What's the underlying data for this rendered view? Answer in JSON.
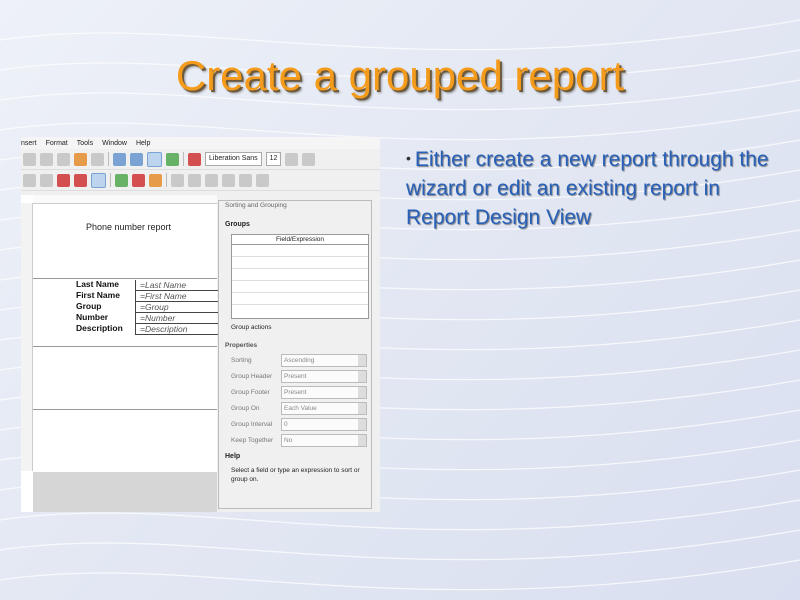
{
  "slide": {
    "title": "Create a grouped report",
    "bullet": "Either create a new report through the wizard or edit an existing report in Report Design View"
  },
  "app": {
    "menu": [
      "nsert",
      "Format",
      "Tools",
      "Window",
      "Help"
    ],
    "font_name": "Liberation Sans",
    "font_size": "12"
  },
  "report": {
    "page_title": "Phone number report",
    "labels": [
      "Last Name",
      "First Name",
      "Group",
      "Number",
      "Description"
    ],
    "fields": [
      "=Last Name",
      "=First Name",
      "=Group",
      "=Number",
      "=Description"
    ]
  },
  "sorting_panel": {
    "title": "Sorting and Grouping",
    "groups_label": "Groups",
    "column_header": "Field/Expression",
    "group_actions": "Group actions",
    "properties_label": "Properties",
    "properties": [
      {
        "label": "Sorting",
        "value": "Ascending"
      },
      {
        "label": "Group Header",
        "value": "Present"
      },
      {
        "label": "Group Footer",
        "value": "Present"
      },
      {
        "label": "Group On",
        "value": "Each Value"
      },
      {
        "label": "Group Interval",
        "value": "0"
      },
      {
        "label": "Keep Together",
        "value": "No"
      }
    ],
    "help_label": "Help",
    "help_text": "Select a field or type an expression to sort or group on."
  }
}
